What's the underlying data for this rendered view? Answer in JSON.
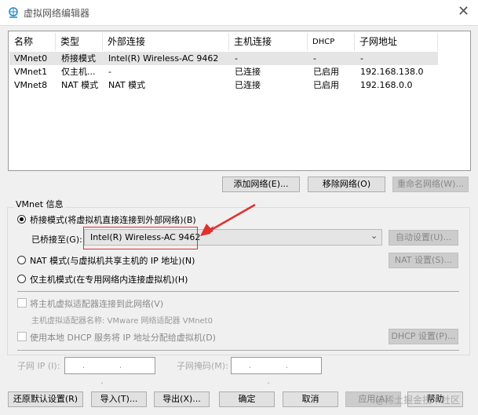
{
  "window": {
    "title": "虚拟网络编辑器",
    "close_icon": "close-icon"
  },
  "table": {
    "headers": [
      "名称",
      "类型",
      "外部连接",
      "主机连接",
      "DHCP",
      "子网地址"
    ],
    "rows": [
      [
        "VMnet0",
        "桥接模式",
        "Intel(R) Wireless-AC 9462",
        "-",
        "-",
        "-"
      ],
      [
        "VMnet1",
        "仅主机...",
        "-",
        "已连接",
        "已启用",
        "192.168.138.0"
      ],
      [
        "VMnet8",
        "NAT 模式",
        "NAT 模式",
        "已连接",
        "已启用",
        "192.168.0.0"
      ]
    ]
  },
  "list_buttons": {
    "add": "添加网络(E)...",
    "remove": "移除网络(O)",
    "rename": "重命名网络(W)..."
  },
  "info": {
    "group_label": "VMnet 信息",
    "bridged": "桥接模式(将虚拟机直接连接到外部网络)(B)",
    "bridged_to_label": "已桥接至(G):",
    "bridged_to_value": "Intel(R) Wireless-AC 9462",
    "auto": "自动设置(U)...",
    "nat": "NAT 模式(与虚拟机共享主机的 IP 地址)(N)",
    "nat_settings": "NAT 设置(S)...",
    "hostonly": "仅主机模式(在专用网络内连接虚拟机)(H)",
    "connect_adapter": "将主机虚拟适配器连接到此网络(V)",
    "adapter_name": "主机虚拟适配器名称: VMware 网络适配器 VMnet0",
    "dhcp": "使用本地 DHCP 服务将 IP 地址分配给虚拟机(D)",
    "dhcp_settings": "DHCP 设置(P)...",
    "subnet_ip_label": "子网 IP (I):",
    "subnet_ip_value": ". . .",
    "subnet_mask_label": "子网掩码(M):",
    "subnet_mask_value": ". . ."
  },
  "bottom": {
    "restore": "还原默认设置(R)",
    "import": "导入(T)...",
    "export": "导出(X)...",
    "ok": "确定",
    "cancel": "取消",
    "apply": "应用(A)",
    "help": "帮助"
  },
  "watermark": "@稀土掘金技术社区",
  "colors": {
    "annotation": "#e03030"
  }
}
